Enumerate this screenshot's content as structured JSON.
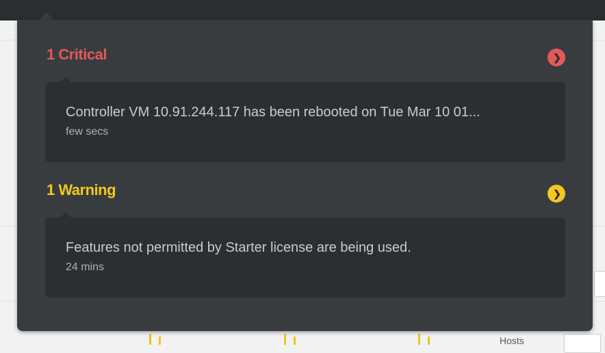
{
  "alerts_popover": {
    "critical": {
      "title": "1 Critical",
      "icon": "arrow-right-circle-icon",
      "color": "#e4585c",
      "items": [
        {
          "message": "Controller VM 10.91.244.117 has been rebooted on Tue Mar 10 01...",
          "time": "few secs"
        }
      ]
    },
    "warning": {
      "title": "1 Warning",
      "icon": "arrow-right-circle-icon",
      "color": "#f5c71d",
      "items": [
        {
          "message": "Features not permitted by Starter license are being used.",
          "time": "24 mins"
        }
      ]
    }
  },
  "background": {
    "hosts_label": "Hosts"
  },
  "colors": {
    "popover_bg": "#383c3e",
    "card_bg": "#2c2f30",
    "topbar_bg": "#2b2e2e"
  }
}
